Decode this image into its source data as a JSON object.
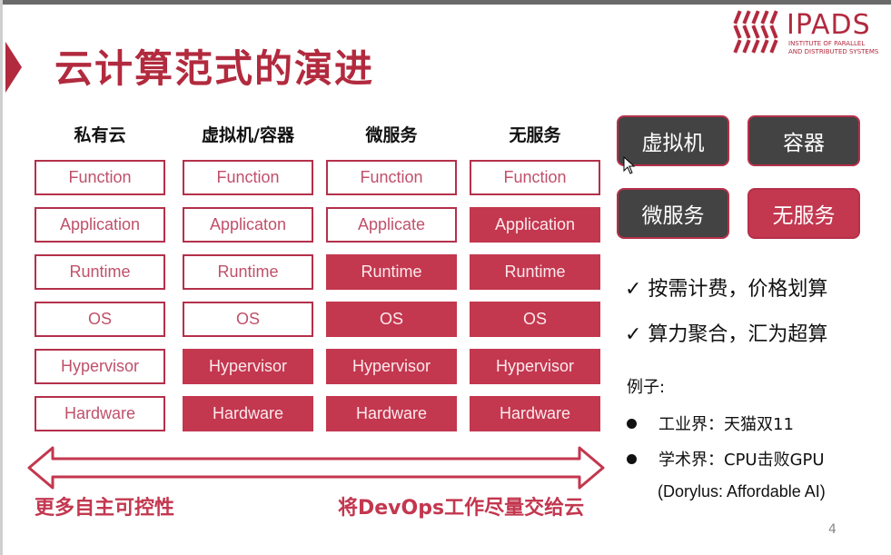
{
  "title": "云计算范式的演进",
  "logo": {
    "name": "IPADS",
    "subtitle_line1": "INSTITUTE OF PARALLEL",
    "subtitle_line2": "AND DISTRIBUTED SYSTEMS"
  },
  "columns": [
    {
      "header": "私有云",
      "layers": [
        {
          "label": "Function",
          "managed": false
        },
        {
          "label": "Application",
          "managed": false
        },
        {
          "label": "Runtime",
          "managed": false
        },
        {
          "label": "OS",
          "managed": false
        },
        {
          "label": "Hypervisor",
          "managed": false
        },
        {
          "label": "Hardware",
          "managed": false
        }
      ]
    },
    {
      "header": "虚拟机/容器",
      "layers": [
        {
          "label": "Function",
          "managed": false
        },
        {
          "label": "Applicaton",
          "managed": false
        },
        {
          "label": "Runtime",
          "managed": false
        },
        {
          "label": "OS",
          "managed": false
        },
        {
          "label": "Hypervisor",
          "managed": true
        },
        {
          "label": "Hardware",
          "managed": true
        }
      ]
    },
    {
      "header": "微服务",
      "layers": [
        {
          "label": "Function",
          "managed": false
        },
        {
          "label": "Applicate",
          "managed": false
        },
        {
          "label": "Runtime",
          "managed": true
        },
        {
          "label": "OS",
          "managed": true
        },
        {
          "label": "Hypervisor",
          "managed": true
        },
        {
          "label": "Hardware",
          "managed": true
        }
      ]
    },
    {
      "header": "无服务",
      "layers": [
        {
          "label": "Function",
          "managed": false
        },
        {
          "label": "Application",
          "managed": true
        },
        {
          "label": "Runtime",
          "managed": true
        },
        {
          "label": "OS",
          "managed": true
        },
        {
          "label": "Hypervisor",
          "managed": true
        },
        {
          "label": "Hardware",
          "managed": true
        }
      ]
    }
  ],
  "paradigm_buttons": [
    {
      "label": "虚拟机",
      "style": "dark"
    },
    {
      "label": "容器",
      "style": "dark"
    },
    {
      "label": "微服务",
      "style": "dark"
    },
    {
      "label": "无服务",
      "style": "red"
    }
  ],
  "benefits": [
    "✓ 按需计费，价格划算",
    "✓ 算力聚合，汇为超算"
  ],
  "examples": {
    "heading": "例子:",
    "items": [
      "工业界：天猫双11",
      "学术界：CPU击败GPU"
    ],
    "paper": "(Dorylus: Affordable AI)"
  },
  "arrow": {
    "left_label": "更多自主可控性",
    "right_label": "将DevOps工作尽量交给云"
  },
  "page_number": "4",
  "colors": {
    "accent": "#c3374f",
    "dark_button": "#434343",
    "text": "#111111"
  }
}
